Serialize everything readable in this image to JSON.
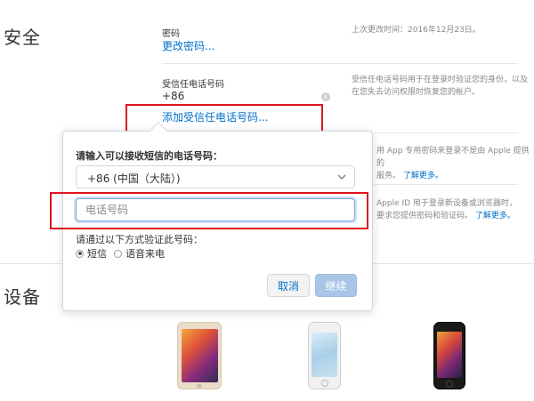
{
  "security": {
    "title": "安全",
    "password_label": "密码",
    "change_password_link": "更改密码...",
    "last_changed": "上次更改时间：2016年12月23日。",
    "trusted_phone_label": "受信任电话号码",
    "trusted_phone_value": "+86",
    "add_trusted_phone_link": "添加受信任电话号码...",
    "trusted_phone_help_1": "受信任电话号码用于在登录时验证您的身份，以及",
    "trusted_phone_help_2": "在您失去访问权限时恢复您的帐户。",
    "app_password_help_1": "用 App 专用密码来登录不是由 Apple 提供的",
    "app_password_help_2": "服务。",
    "learn_more": "了解更多。",
    "twofactor_help_1": "Apple ID 用于登录新设备或浏览器时，",
    "twofactor_help_2": "要求您提供密码和验证码。"
  },
  "popover": {
    "title": "请输入可以接收短信的电话号码：",
    "country_selected": "+86 (中国（大陆）)",
    "phone_placeholder": "电话号码",
    "verify_label": "请通过以下方式验证此号码：",
    "radio_sms": "短信",
    "radio_voice": "语音来电",
    "cancel": "取消",
    "continue": "继续"
  },
  "devices": {
    "title": "设备"
  },
  "colors": {
    "link": "#0070c9",
    "highlight": "#e0141e"
  }
}
